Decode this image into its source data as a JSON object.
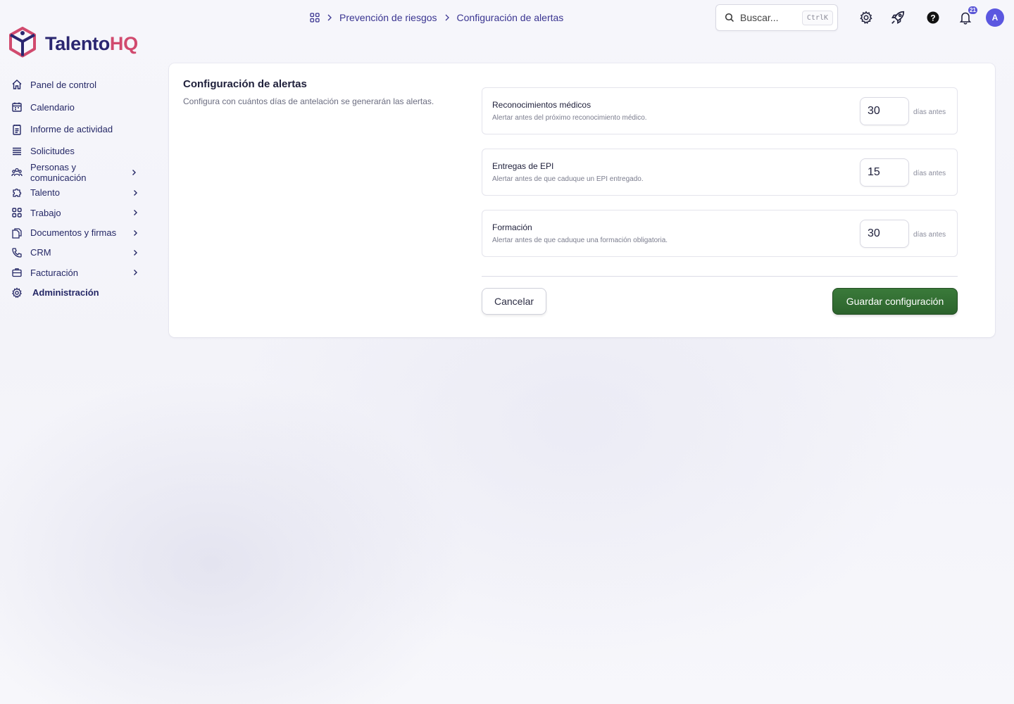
{
  "brand": {
    "name_part1": "Talento",
    "name_part2": "HQ"
  },
  "sidebar": {
    "items": [
      {
        "label": "Panel de control",
        "icon": "home-icon"
      },
      {
        "label": "Calendario",
        "icon": "calendar-icon"
      },
      {
        "label": "Informe de actividad",
        "icon": "report-icon"
      },
      {
        "label": "Solicitudes",
        "icon": "list-icon"
      },
      {
        "label": "Personas y comunicación",
        "icon": "people-icon"
      },
      {
        "label": "Talento",
        "icon": "puzzle-icon"
      },
      {
        "label": "Trabajo",
        "icon": "grid-icon"
      },
      {
        "label": "Documentos y firmas",
        "icon": "documents-icon"
      },
      {
        "label": "CRM",
        "icon": "phone-icon"
      },
      {
        "label": "Facturación",
        "icon": "briefcase-icon"
      },
      {
        "label": "Administración",
        "icon": "gear-icon"
      }
    ]
  },
  "header": {
    "breadcrumb": [
      "Prevención de riesgos",
      "Configuración de alertas"
    ],
    "search_placeholder": "Buscar...",
    "search_shortcut": "CtrlK",
    "notification_count": "21",
    "avatar_initial": "A"
  },
  "main": {
    "title": "Configuración de alertas",
    "description": "Configura con cuántos días de antelación se generarán las alertas.",
    "alerts": [
      {
        "title": "Reconocimientos médicos",
        "description": "Alertar antes del próximo reconocimiento médico.",
        "value": "30",
        "unit": "días antes"
      },
      {
        "title": "Entregas de EPI",
        "description": "Alertar antes de que caduque un EPI entregado.",
        "value": "15",
        "unit": "días antes"
      },
      {
        "title": "Formación",
        "description": "Alertar antes de que caduque una formación obligatoria.",
        "value": "30",
        "unit": "días antes"
      }
    ],
    "cancel_label": "Cancelar",
    "save_label": "Guardar configuración"
  },
  "colors": {
    "brand_navy": "#2a2670",
    "brand_pink": "#d14a6e",
    "accent": "#5b57e0",
    "save_green": "#2f6b2f"
  }
}
